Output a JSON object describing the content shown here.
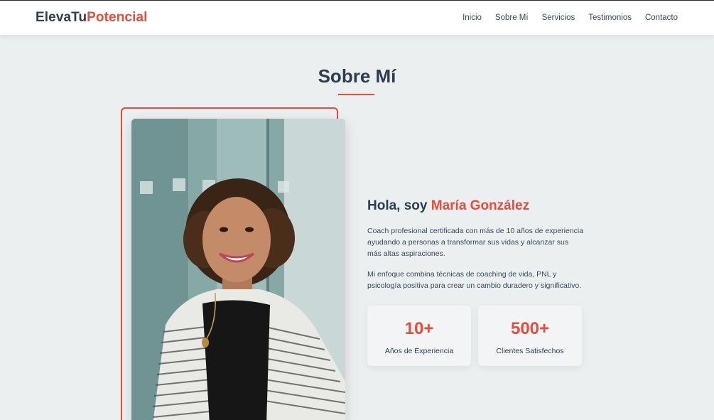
{
  "brand": {
    "part1": "ElevaTu",
    "part2": "Potencial"
  },
  "nav": {
    "items": [
      {
        "label": "Inicio"
      },
      {
        "label": "Sobre Mí"
      },
      {
        "label": "Servicios"
      },
      {
        "label": "Testimonios"
      },
      {
        "label": "Contacto"
      }
    ]
  },
  "about": {
    "title": "Sobre Mí",
    "greeting_prefix": "Hola, soy ",
    "name": "María González",
    "paragraph1": "Coach profesional certificada con más de 10 años de experiencia ayudando a personas a transformar sus vidas y alcanzar sus más altas aspiraciones.",
    "paragraph2": "Mi enfoque combina técnicas de coaching de vida, PNL y psicología positiva para crear un cambio duradero y significativo.",
    "stats": [
      {
        "value": "10+",
        "label": "Años de Experiencia"
      },
      {
        "value": "500+",
        "label": "Clientes Satisfechos"
      }
    ]
  },
  "colors": {
    "accent": "#e74c3c",
    "primary": "#2c3e50",
    "background": "#eceff0"
  }
}
